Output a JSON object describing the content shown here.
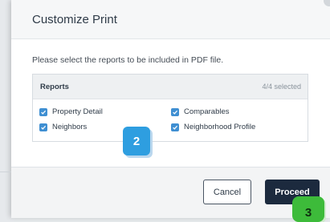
{
  "dialog": {
    "title": "Customize Print",
    "instruction": "Please select the reports to be included in PDF file.",
    "panel": {
      "title": "Reports",
      "selected_count": "4/4 selected",
      "options": [
        {
          "label": "Property Detail",
          "checked": true
        },
        {
          "label": "Comparables",
          "checked": true
        },
        {
          "label": "Neighbors",
          "checked": true
        },
        {
          "label": "Neighborhood Profile",
          "checked": true
        }
      ]
    },
    "buttons": {
      "cancel": "Cancel",
      "proceed": "Proceed"
    }
  },
  "callouts": {
    "step_2": "2",
    "step_3": "3"
  },
  "colors": {
    "accent": "#3f8fd2",
    "proceed_bg": "#1c2a3e",
    "callout_blue": "#2e9ee0",
    "callout_green": "#3dbb3a"
  }
}
